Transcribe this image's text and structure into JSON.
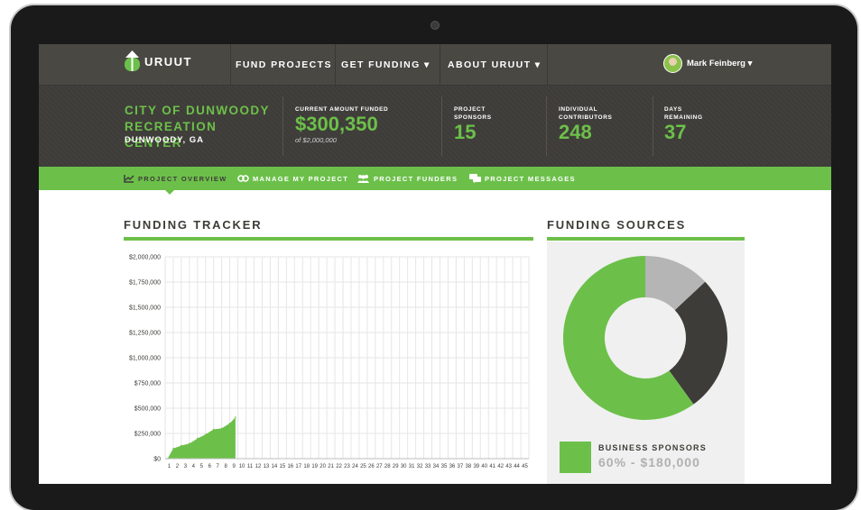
{
  "brand": {
    "name": "URUUT",
    "accent": "#6cc04a",
    "dark": "#3e3c38"
  },
  "nav": {
    "items": [
      {
        "label": "FUND PROJECTS"
      },
      {
        "label": "GET FUNDING ▾"
      },
      {
        "label": "ABOUT URUUT ▾"
      }
    ],
    "user": "Mark Feinberg ▾"
  },
  "project": {
    "name": "CITY OF DUNWOODY RECREATION CENTER",
    "location": "DUNWOODY, GA",
    "current_label": "CURRENT AMOUNT FUNDED",
    "current_value": "$300,350",
    "goal": "of $2,000,000",
    "sponsors_label": "PROJECT SPONSORS",
    "sponsors_value": "15",
    "contributors_label": "INDIVIDUAL CONTRIBUTORS",
    "contributors_value": "248",
    "days_label": "DAYS REMAINING",
    "days_value": "37"
  },
  "tabs": [
    {
      "label": "PROJECT OVERVIEW",
      "icon": "chart-icon"
    },
    {
      "label": "MANAGE MY PROJECT",
      "icon": "link-icon"
    },
    {
      "label": "PROJECT FUNDERS",
      "icon": "people-icon"
    },
    {
      "label": "PROJECT MESSAGES",
      "icon": "chat-icon"
    }
  ],
  "tracker": {
    "title": "FUNDING TRACKER"
  },
  "sources": {
    "title": "FUNDING SOURCES",
    "legend_title": "BUSINESS SPONSORS",
    "legend_value": "60% - $180,000"
  },
  "chart_data": [
    {
      "type": "area",
      "title": "FUNDING TRACKER",
      "xlabel": "",
      "ylabel": "",
      "x": [
        1,
        2,
        3,
        4,
        5,
        6,
        7,
        8,
        9,
        10,
        11,
        12,
        13,
        14,
        15,
        16,
        17,
        18,
        19,
        20,
        21,
        22,
        23,
        24,
        25,
        26,
        27,
        28,
        29,
        30,
        31,
        32,
        33,
        34,
        35,
        36,
        37,
        38,
        39,
        40,
        41,
        42,
        43,
        44,
        45
      ],
      "y_ticks": [
        "$0",
        "$250,000",
        "$500,000",
        "$750,000",
        "$1,000,000",
        "$1,250,000",
        "$1,500,000",
        "$1,750,000",
        "$2,000,000"
      ],
      "ylim": [
        0,
        2000000
      ],
      "series": [
        {
          "color": "#6cc04a",
          "points": [
            [
              0.3,
              0
            ],
            [
              1,
              100000
            ],
            [
              2,
              130000
            ],
            [
              3,
              150000
            ],
            [
              4,
              200000
            ],
            [
              5,
              240000
            ],
            [
              6,
              290000
            ],
            [
              7,
              300000
            ],
            [
              8,
              350000
            ],
            [
              8.7,
              410000
            ]
          ]
        }
      ],
      "grid": true
    },
    {
      "type": "pie",
      "title": "FUNDING SOURCES",
      "donut": true,
      "slices": [
        {
          "label": "BUSINESS SPONSORS",
          "value": 60,
          "color": "#6cc04a"
        },
        {
          "value": 27,
          "color": "#3e3c38"
        },
        {
          "value": 13,
          "color": "#b5b5b5"
        }
      ]
    }
  ]
}
